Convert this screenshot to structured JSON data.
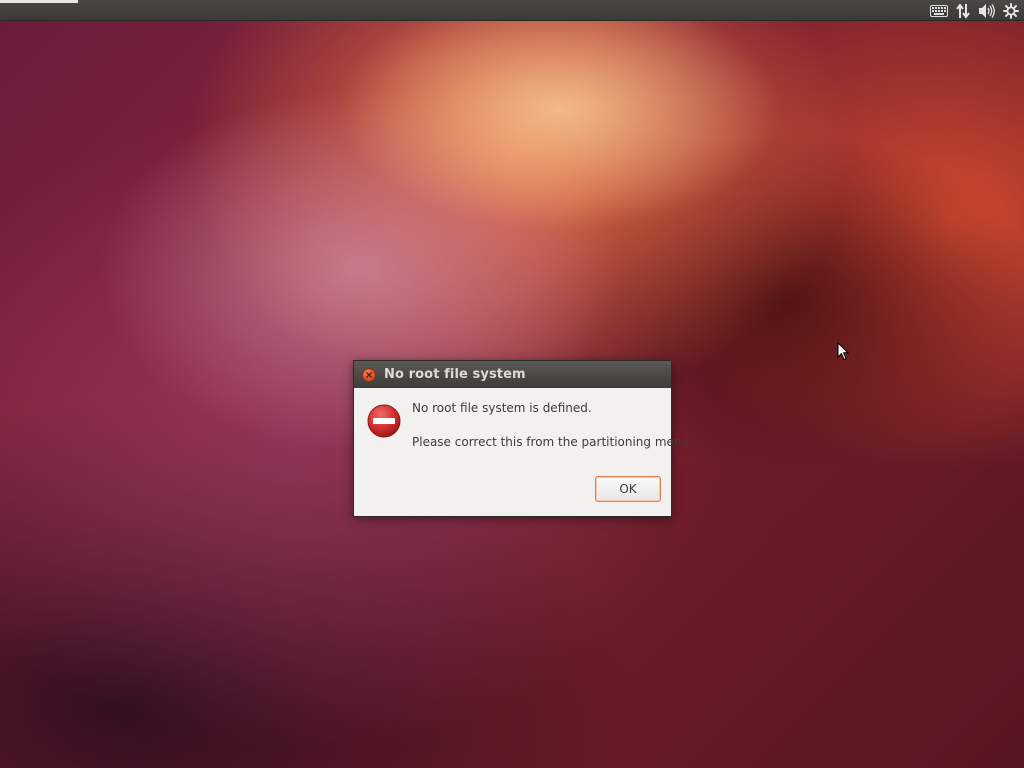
{
  "desktop": {
    "top_panel": {
      "indicators": [
        {
          "icon": "keyboard-icon"
        },
        {
          "icon": "network-arrows-icon"
        },
        {
          "icon": "volume-icon"
        },
        {
          "icon": "gear-icon"
        }
      ]
    }
  },
  "dialog": {
    "title": "No root file system",
    "message_primary": "No root file system is defined.",
    "message_secondary": "Please correct this from the partitioning menu.",
    "ok_label": "OK",
    "icon": "error-stop-icon",
    "close_icon": "close-icon"
  },
  "colors": {
    "panel": "#3b3a36",
    "dialog_bg": "#f2f1f0",
    "close_button": "#e0532a",
    "error_icon": "#d42f2f",
    "ok_focus_border": "#e37f50"
  }
}
